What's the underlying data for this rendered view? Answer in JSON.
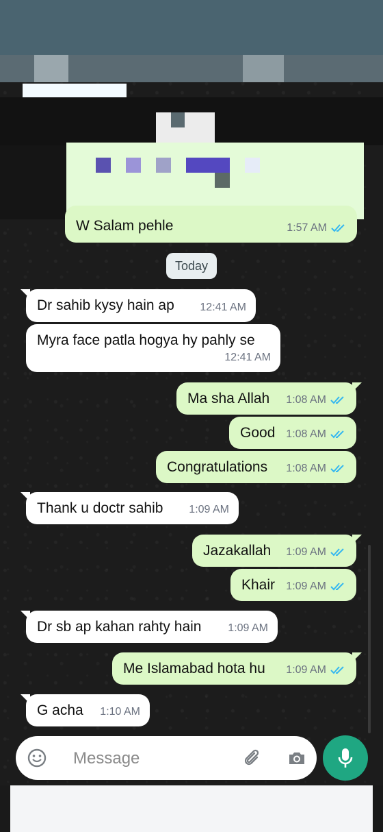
{
  "chat": {
    "date_chip": "Today",
    "messages": [
      {
        "dir": "out",
        "text": "W Salam pehle",
        "time": "1:57 AM"
      },
      {
        "dir": "in",
        "text": "Dr sahib kysy hain ap",
        "time": "12:41 AM"
      },
      {
        "dir": "in",
        "text": "Myra face patla hogya hy pahly se",
        "time": "12:41 AM"
      },
      {
        "dir": "out",
        "text": "Ma sha Allah",
        "time": "1:08 AM"
      },
      {
        "dir": "out",
        "text": "Good",
        "time": "1:08 AM"
      },
      {
        "dir": "out",
        "text": "Congratulations",
        "time": "1:08 AM"
      },
      {
        "dir": "in",
        "text": "Thank u doctr sahib",
        "time": "1:09 AM"
      },
      {
        "dir": "out",
        "text": "Jazakallah",
        "time": "1:09 AM"
      },
      {
        "dir": "out",
        "text": "Khair",
        "time": "1:09 AM"
      },
      {
        "dir": "in",
        "text": "Dr sb ap kahan rahty hain",
        "time": "1:09 AM"
      },
      {
        "dir": "out",
        "text": "Me Islamabad hota hu",
        "time": "1:09 AM"
      },
      {
        "dir": "in",
        "text": "G acha",
        "time": "1:10 AM"
      }
    ]
  },
  "input": {
    "placeholder": "Message",
    "icons": [
      "emoji-icon",
      "attach-icon",
      "camera-icon",
      "mic-icon"
    ]
  },
  "colors": {
    "outgoing_bubble": "#dcf8c6",
    "incoming_bubble": "#ffffff",
    "read_tick": "#34b7f1",
    "mic_button": "#1fa782"
  }
}
